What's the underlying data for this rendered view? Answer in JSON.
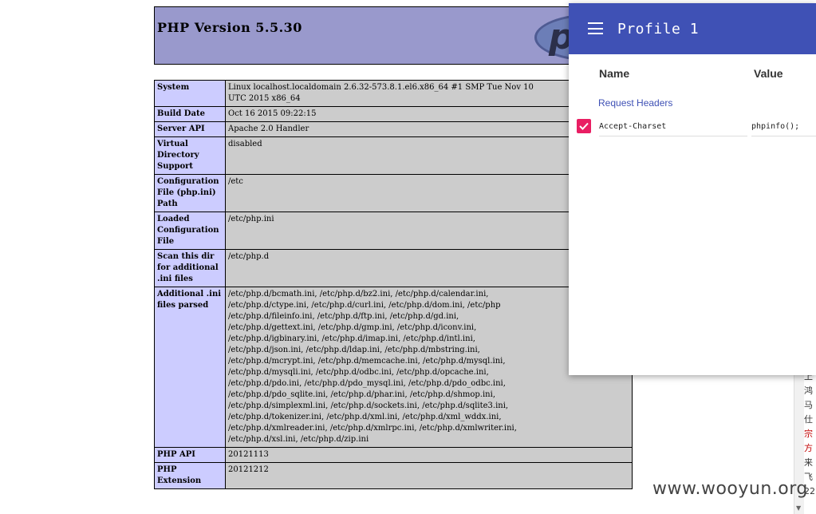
{
  "php": {
    "title": "PHP Version 5.5.30",
    "logo_text": "php"
  },
  "table": [
    {
      "key": "System",
      "value": "Linux localhost.localdomain 2.6.32-573.8.1.el6.x86_64 #1 SMP Tue Nov 10\nUTC 2015 x86_64"
    },
    {
      "key": "Build Date",
      "value": "Oct 16 2015 09:22:15"
    },
    {
      "key": "Server API",
      "value": "Apache 2.0 Handler"
    },
    {
      "key": "Virtual Directory Support",
      "value": "disabled"
    },
    {
      "key": "Configuration File (php.ini) Path",
      "value": "/etc"
    },
    {
      "key": "Loaded Configuration File",
      "value": "/etc/php.ini"
    },
    {
      "key": "Scan this dir for additional .ini files",
      "value": "/etc/php.d"
    },
    {
      "key": "Additional .ini files parsed",
      "value": "/etc/php.d/bcmath.ini, /etc/php.d/bz2.ini, /etc/php.d/calendar.ini,\n/etc/php.d/ctype.ini, /etc/php.d/curl.ini, /etc/php.d/dom.ini, /etc/php\n/etc/php.d/fileinfo.ini, /etc/php.d/ftp.ini, /etc/php.d/gd.ini,\n/etc/php.d/gettext.ini, /etc/php.d/gmp.ini, /etc/php.d/iconv.ini,\n/etc/php.d/igbinary.ini, /etc/php.d/imap.ini, /etc/php.d/intl.ini,\n/etc/php.d/json.ini, /etc/php.d/ldap.ini, /etc/php.d/mbstring.ini,\n/etc/php.d/mcrypt.ini, /etc/php.d/memcache.ini, /etc/php.d/mysql.ini,\n/etc/php.d/mysqli.ini, /etc/php.d/odbc.ini, /etc/php.d/opcache.ini,\n/etc/php.d/pdo.ini, /etc/php.d/pdo_mysql.ini, /etc/php.d/pdo_odbc.ini,\n/etc/php.d/pdo_sqlite.ini, /etc/php.d/phar.ini, /etc/php.d/shmop.ini,\n/etc/php.d/simplexml.ini, /etc/php.d/sockets.ini, /etc/php.d/sqlite3.ini,\n/etc/php.d/tokenizer.ini, /etc/php.d/xml.ini, /etc/php.d/xml_wddx.ini,\n/etc/php.d/xmlreader.ini, /etc/php.d/xmlrpc.ini, /etc/php.d/xmlwriter.ini,\n/etc/php.d/xsl.ini, /etc/php.d/zip.ini"
    },
    {
      "key": "PHP API",
      "value": "20121113"
    },
    {
      "key": "PHP Extension",
      "value": "20121212"
    }
  ],
  "panel": {
    "title": "Profile 1",
    "col_name": "Name",
    "col_value": "Value",
    "section": "Request Headers",
    "header_name": "Accept-Charset",
    "header_value": "phpinfo();",
    "accent": "#3f51b5",
    "checkbox_color": "#e91e63"
  },
  "side_chars": [
    "上",
    "鸿",
    "马",
    "仕",
    "宗",
    "方",
    "来",
    "飞"
  ],
  "side_red": [
    4,
    5
  ],
  "side_tail": "22",
  "watermark": "www.wooyun.org"
}
